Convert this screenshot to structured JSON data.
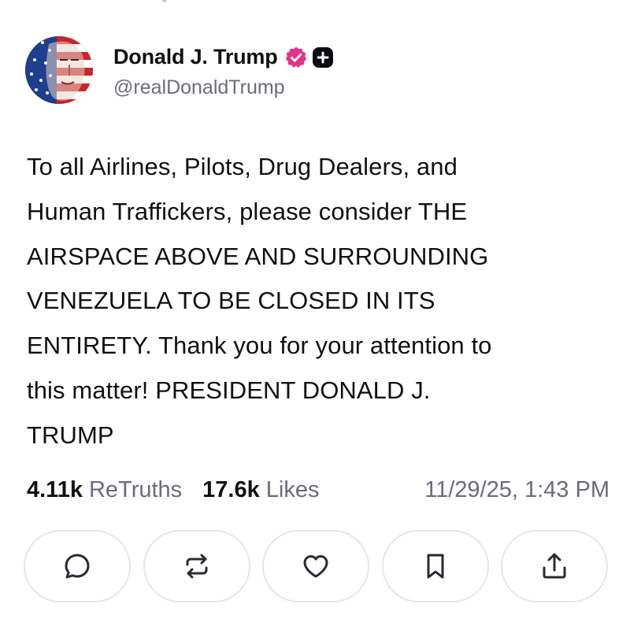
{
  "post": {
    "author": {
      "display_name": "Donald J. Trump",
      "handle": "@realDonaldTrump",
      "verified_icon": "verified-badge-icon",
      "membership_icon": "truth-plus-icon",
      "verified_color": "#e4338a"
    },
    "text": "To all Airlines, Pilots, Drug Dealers, and\nHuman Traffickers, please consider THE\nAIRSPACE ABOVE AND SURROUNDING\nVENEZUELA TO BE CLOSED IN ITS\nENTIRETY. Thank you for your attention to\nthis matter! PRESIDENT DONALD J.\nTRUMP",
    "stats": {
      "retruths_count": "4.11k",
      "retruths_label": "ReTruths",
      "likes_count": "17.6k",
      "likes_label": "Likes"
    },
    "timestamp": "11/29/25, 1:43 PM"
  },
  "actions": [
    {
      "name": "reply",
      "icon": "reply-icon"
    },
    {
      "name": "retruth",
      "icon": "retruth-icon"
    },
    {
      "name": "like",
      "icon": "heart-icon"
    },
    {
      "name": "bookmark",
      "icon": "bookmark-icon"
    },
    {
      "name": "share",
      "icon": "share-icon"
    }
  ],
  "colors": {
    "text_primary": "#111111",
    "text_secondary": "#6b6b76",
    "button_border": "#e6e6ea",
    "icon_color": "#2a2a33"
  }
}
